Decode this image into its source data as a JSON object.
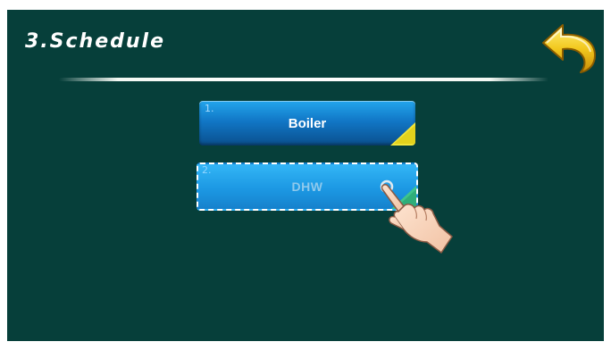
{
  "screen": {
    "title": "3.Schedule",
    "background_color": "#063f3a"
  },
  "header": {
    "back_icon": "back-arrow-icon",
    "back_icon_color": "#f2c81e"
  },
  "menu": {
    "items": [
      {
        "number": "1.",
        "label": "Boiler",
        "state": "normal",
        "corner_color": "#f0e63a"
      },
      {
        "number": "2.",
        "label": "DHW",
        "state": "selected",
        "corner_color": "#3fc48c"
      }
    ]
  },
  "pointer": {
    "icon": "hand-pointer-icon"
  }
}
